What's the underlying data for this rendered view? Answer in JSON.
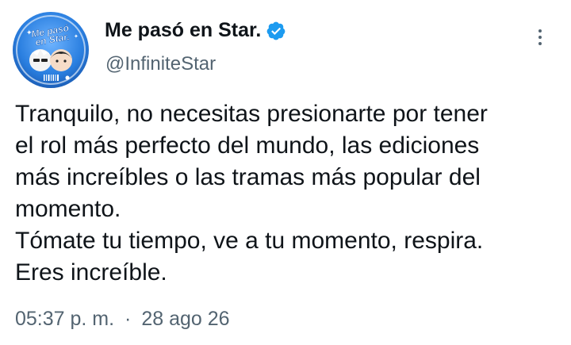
{
  "author": {
    "display_name": "Me pasó en Star.",
    "handle": "@InfiniteStar",
    "verified": true,
    "avatar_text_line1": "Me pasó",
    "avatar_text_line2": "en Star."
  },
  "tweet": {
    "lines": [
      "Tranquilo, no necesitas presionarte por tener",
      "el rol más perfecto del mundo, las ediciones",
      "más increíbles o las tramas más popular del",
      "momento.",
      "Tómate tu tiempo, ve a tu momento, respira.",
      "Eres increíble."
    ],
    "time": "05:37 p. m.",
    "separator": "·",
    "date": "28 ago 26"
  },
  "colors": {
    "text_primary": "#0f1419",
    "text_secondary": "#536471",
    "verified_blue": "#1d9bf0",
    "avatar_blue": "#2a7fe0"
  },
  "icons": {
    "verified": "verified-badge-icon",
    "more": "more-vertical-icon"
  }
}
